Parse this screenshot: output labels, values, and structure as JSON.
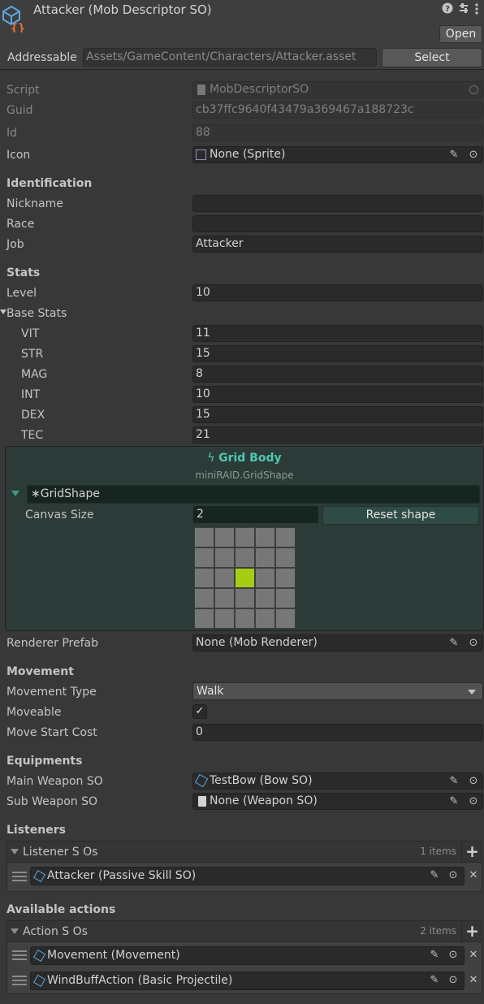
{
  "header": {
    "title": "Attacker (Mob Descriptor SO)",
    "open_label": "Open",
    "addressable_label": "Addressable",
    "address_path": "Assets/GameContent/Characters/Attacker.asset",
    "select_label": "Select"
  },
  "props": {
    "script": {
      "label": "Script",
      "value": "MobDescriptorSO"
    },
    "guid": {
      "label": "Guid",
      "value": "cb37ffc9640f43479a369467a188723c"
    },
    "id": {
      "label": "Id",
      "value": "88"
    },
    "icon": {
      "label": "Icon",
      "value": "None (Sprite)"
    }
  },
  "identification": {
    "title": "Identification",
    "nickname": {
      "label": "Nickname",
      "value": ""
    },
    "race": {
      "label": "Race",
      "value": ""
    },
    "job": {
      "label": "Job",
      "value": "Attacker"
    }
  },
  "stats": {
    "title": "Stats",
    "level": {
      "label": "Level",
      "value": "10"
    },
    "base_stats_label": "Base Stats",
    "items": [
      {
        "label": "VIT",
        "value": "11"
      },
      {
        "label": "STR",
        "value": "15"
      },
      {
        "label": "MAG",
        "value": "8"
      },
      {
        "label": "INT",
        "value": "10"
      },
      {
        "label": "DEX",
        "value": "15"
      },
      {
        "label": "TEC",
        "value": "21"
      }
    ]
  },
  "grid_body": {
    "title": "Grid Body",
    "subtitle": "miniRAID.GridShape",
    "shape_label": "GridShape",
    "canvas_size_label": "Canvas Size",
    "canvas_size_value": "2",
    "reset_label": "Reset shape",
    "grid": [
      [
        0,
        0,
        0,
        0,
        0
      ],
      [
        0,
        0,
        0,
        0,
        0
      ],
      [
        0,
        0,
        1,
        0,
        0
      ],
      [
        0,
        0,
        0,
        0,
        0
      ],
      [
        0,
        0,
        0,
        0,
        0
      ]
    ]
  },
  "renderer": {
    "label": "Renderer Prefab",
    "value": "None (Mob Renderer)"
  },
  "movement": {
    "title": "Movement",
    "type": {
      "label": "Movement Type",
      "value": "Walk"
    },
    "moveable": {
      "label": "Moveable",
      "checked": true
    },
    "start_cost": {
      "label": "Move Start Cost",
      "value": "0"
    }
  },
  "equipments": {
    "title": "Equipments",
    "main": {
      "label": "Main Weapon SO",
      "value": "TestBow (Bow SO)"
    },
    "sub": {
      "label": "Sub Weapon SO",
      "value": "None (Weapon SO)"
    }
  },
  "listeners": {
    "title": "Listeners",
    "list_label": "Listener S Os",
    "count": "1 items",
    "items": [
      "Attacker (Passive Skill SO)"
    ]
  },
  "actions": {
    "title": "Available actions",
    "list_label": "Action S Os",
    "count": "2 items",
    "items": [
      "Movement (Movement)",
      "WindBuffAction (Basic Projectile)"
    ]
  },
  "colors": {
    "accent": "#4ec9b0",
    "grid_on": "#a7cc14",
    "panel": "#2c3b37"
  }
}
